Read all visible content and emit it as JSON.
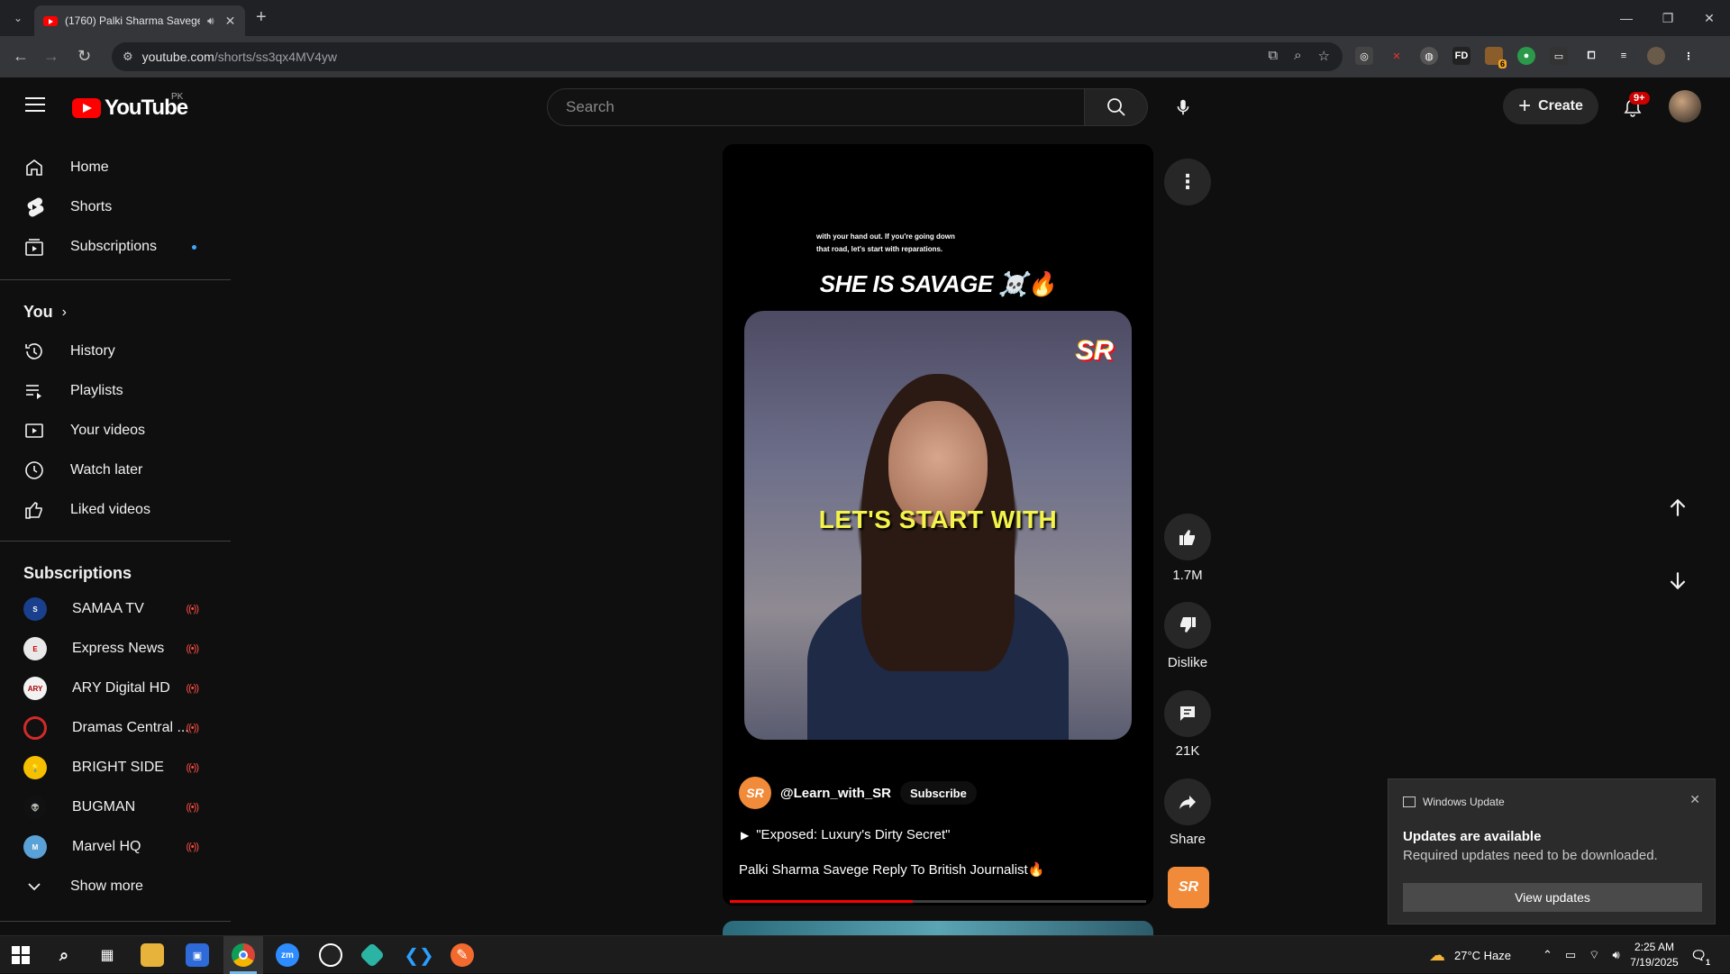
{
  "browser": {
    "tab_title": "(1760) Palki Sharma Savege",
    "url_host": "youtube.com",
    "url_path": "/shorts/ss3qx4MV4yw",
    "extension_badge": "6"
  },
  "header": {
    "logo_text": "YouTube",
    "country_code": "PK",
    "search_placeholder": "Search",
    "create_label": "Create",
    "notification_badge": "9+"
  },
  "sidebar": {
    "main": [
      {
        "label": "Home",
        "icon": "home-icon"
      },
      {
        "label": "Shorts",
        "icon": "shorts-icon"
      },
      {
        "label": "Subscriptions",
        "icon": "subscriptions-icon"
      }
    ],
    "you_heading": "You",
    "you_items": [
      {
        "label": "History",
        "icon": "history-icon"
      },
      {
        "label": "Playlists",
        "icon": "playlists-icon"
      },
      {
        "label": "Your videos",
        "icon": "your-videos-icon"
      },
      {
        "label": "Watch later",
        "icon": "watch-later-icon"
      },
      {
        "label": "Liked videos",
        "icon": "thumbs-up-icon"
      }
    ],
    "subs_heading": "Subscriptions",
    "subscriptions": [
      {
        "label": "SAMAA TV",
        "color": "#1a3f8c"
      },
      {
        "label": "Express News",
        "color": "#e9e9e9"
      },
      {
        "label": "ARY Digital HD",
        "color": "#f2f2f2"
      },
      {
        "label": "Dramas Central ...",
        "color": "#d22a2a"
      },
      {
        "label": "BRIGHT SIDE",
        "color": "#f6c000"
      },
      {
        "label": "BUGMAN",
        "color": "#111111"
      },
      {
        "label": "Marvel HQ",
        "color": "#5aa1d8"
      }
    ],
    "show_more": "Show more"
  },
  "short": {
    "overlay_caption": "with your hand out. If you're going down that road, let's start with reparations.",
    "headline": "SHE IS SAVAGE ☠️🔥",
    "subtitle": "LET'S START WITH",
    "watermark": "SR",
    "channel": "@Learn_with_SR",
    "subscribe_label": "Subscribe",
    "description": "\"Exposed: Luxury's Dirty Secret\"",
    "title": "Palki Sharma Savege Reply To British Journalist🔥",
    "progress": 0.44
  },
  "actions": {
    "likes": "1.7M",
    "dislike": "Dislike",
    "comments": "21K",
    "share": "Share"
  },
  "toast": {
    "app": "Windows Update",
    "title": "Updates are available",
    "body": "Required updates need to be downloaded.",
    "button": "View updates"
  },
  "taskbar": {
    "weather": "27°C  Haze",
    "time": "2:25 AM",
    "date": "7/19/2025",
    "notif_count": "1"
  }
}
